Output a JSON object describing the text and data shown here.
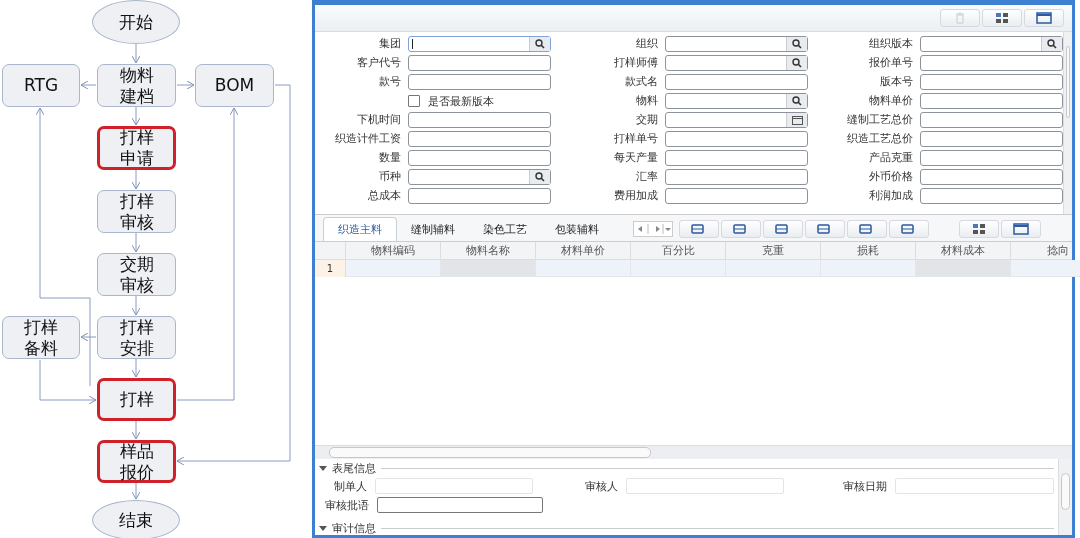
{
  "flowchart": {
    "nodes": [
      {
        "lines": [
          "开始"
        ],
        "kind": "terminal",
        "highlighted": false
      },
      {
        "lines": [
          "RTG"
        ],
        "kind": "step",
        "highlighted": false
      },
      {
        "lines": [
          "物料",
          "建档"
        ],
        "kind": "step",
        "highlighted": false
      },
      {
        "lines": [
          "BOM"
        ],
        "kind": "step",
        "highlighted": false
      },
      {
        "lines": [
          "打样",
          "申请"
        ],
        "kind": "step",
        "highlighted": true
      },
      {
        "lines": [
          "打样",
          "审核"
        ],
        "kind": "step",
        "highlighted": false
      },
      {
        "lines": [
          "交期",
          "审核"
        ],
        "kind": "step",
        "highlighted": false
      },
      {
        "lines": [
          "打样",
          "备料"
        ],
        "kind": "step",
        "highlighted": false
      },
      {
        "lines": [
          "打样",
          "安排"
        ],
        "kind": "step",
        "highlighted": false
      },
      {
        "lines": [
          "打样"
        ],
        "kind": "step",
        "highlighted": true
      },
      {
        "lines": [
          "样品",
          "报价"
        ],
        "kind": "step",
        "highlighted": true
      },
      {
        "lines": [
          "结束"
        ],
        "kind": "terminal",
        "highlighted": false
      }
    ]
  },
  "form": {
    "fields": [
      {
        "label": "集团",
        "kind": "search",
        "focused": true
      },
      {
        "label": "组织",
        "kind": "search",
        "focused": false
      },
      {
        "label": "组织版本",
        "kind": "search",
        "focused": false
      },
      {
        "label": "客户代号",
        "kind": "text",
        "focused": false
      },
      {
        "label": "打样师傅",
        "kind": "search",
        "focused": false
      },
      {
        "label": "报价单号",
        "kind": "text",
        "focused": false
      },
      {
        "label": "款号",
        "kind": "text",
        "focused": false
      },
      {
        "label": "款式名",
        "kind": "text",
        "focused": false
      },
      {
        "label": "版本号",
        "kind": "text",
        "focused": false
      },
      {
        "label": "是否最新版本",
        "kind": "checkbox",
        "checked": false
      },
      {
        "label": "物料",
        "kind": "search",
        "focused": false
      },
      {
        "label": "物料单价",
        "kind": "text",
        "focused": false
      },
      {
        "label": "下机时间",
        "kind": "text",
        "focused": false
      },
      {
        "label": "交期",
        "kind": "date",
        "focused": false
      },
      {
        "label": "缝制工艺总价",
        "kind": "text",
        "focused": false
      },
      {
        "label": "织造计件工资",
        "kind": "text",
        "focused": false
      },
      {
        "label": "打样单号",
        "kind": "text",
        "focused": false
      },
      {
        "label": "织造工艺总价",
        "kind": "text",
        "focused": false
      },
      {
        "label": "数量",
        "kind": "text",
        "focused": false
      },
      {
        "label": "每天产量",
        "kind": "text",
        "focused": false
      },
      {
        "label": "产品克重",
        "kind": "text",
        "focused": false
      },
      {
        "label": "币种",
        "kind": "search",
        "focused": false
      },
      {
        "label": "汇率",
        "kind": "text",
        "focused": false
      },
      {
        "label": "外币价格",
        "kind": "text",
        "focused": false
      },
      {
        "label": "总成本",
        "kind": "text",
        "focused": false
      },
      {
        "label": "费用加成",
        "kind": "text",
        "focused": false
      },
      {
        "label": "利润加成",
        "kind": "text",
        "focused": false
      }
    ]
  },
  "tabs": [
    {
      "label": "织造主料",
      "selected": true
    },
    {
      "label": "缝制辅料",
      "selected": false
    },
    {
      "label": "染色工艺",
      "selected": false
    },
    {
      "label": "包装辅料",
      "selected": false
    }
  ],
  "grid": {
    "columns": [
      "物料编码",
      "物料名称",
      "材料单价",
      "百分比",
      "克重",
      "损耗",
      "材料成本",
      "捻向"
    ],
    "rows": [
      {
        "number": "1"
      }
    ]
  },
  "footer": {
    "title": "表尾信息",
    "fields": [
      {
        "label": "制单人"
      },
      {
        "label": "审核人"
      },
      {
        "label": "审核日期"
      },
      {
        "label": "审核批语"
      }
    ],
    "next_section": "审计信息"
  }
}
